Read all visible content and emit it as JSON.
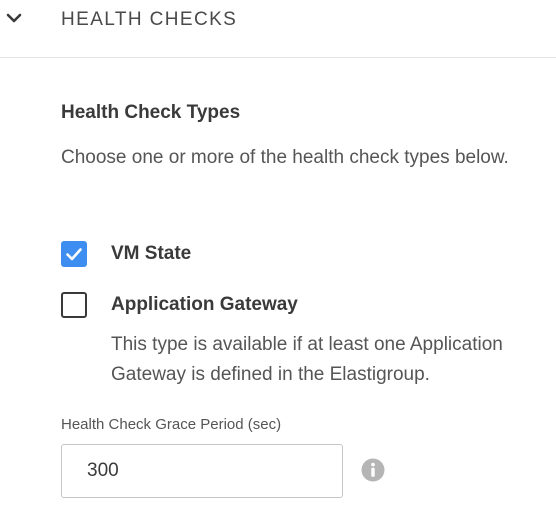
{
  "section": {
    "title": "HEALTH CHECKS",
    "expanded": true
  },
  "health_check_types": {
    "title": "Health Check Types",
    "description": "Choose one or more of the health check types below.",
    "options": [
      {
        "label": "VM State",
        "checked": true
      },
      {
        "label": "Application Gateway",
        "checked": false,
        "help": "This type is available if at least one Application Gateway is defined in the Elastigroup."
      }
    ]
  },
  "grace_period": {
    "label": "Health Check Grace Period (sec)",
    "value": "300"
  },
  "icons": {
    "collapse": "chevron-down-icon",
    "check": "checkmark-icon",
    "info": "info-icon"
  },
  "colors": {
    "checkbox_checked": "#3d8ef0",
    "info_icon": "#b5b5b5"
  }
}
